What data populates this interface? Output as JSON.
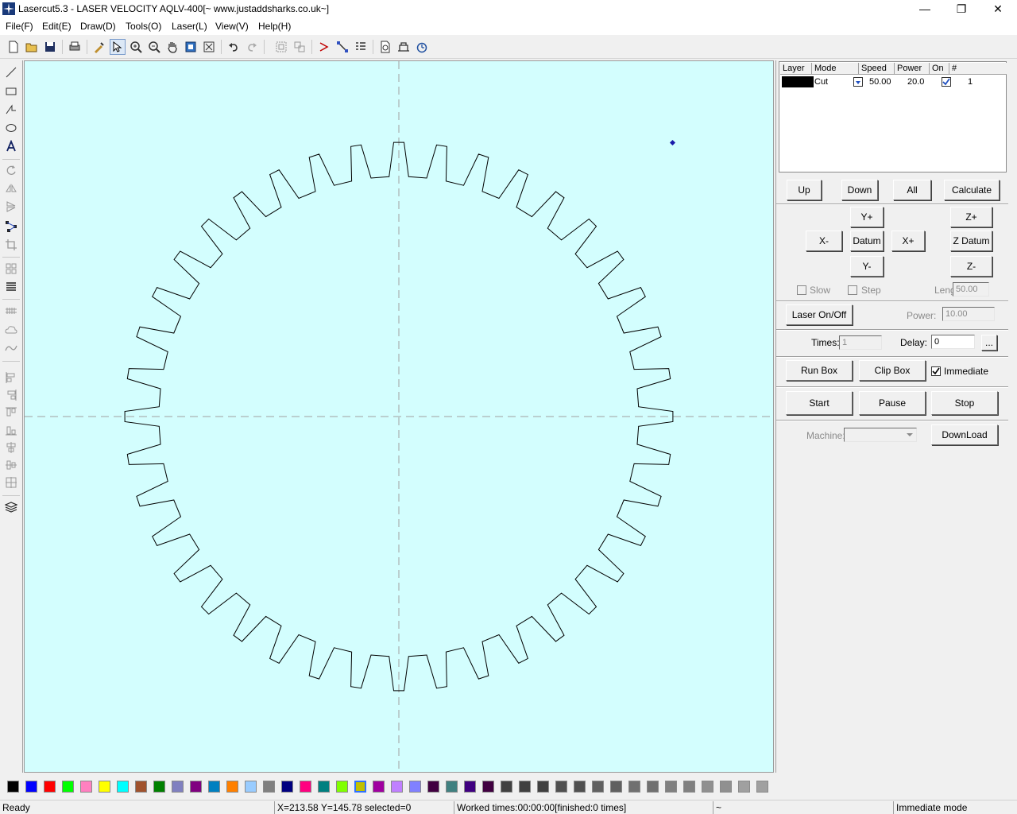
{
  "window": {
    "title": "Lasercut5.3 - LASER VELOCITY AQLV-400[~ www.justaddsharks.co.uk~]",
    "minimize": "—",
    "restore": "❐",
    "close": "✕"
  },
  "menu": [
    {
      "label": "File(F)"
    },
    {
      "label": "Edit(E)"
    },
    {
      "label": "Draw(D)"
    },
    {
      "label": "Tools(O)"
    },
    {
      "label": "Laser(L)"
    },
    {
      "label": "View(V)"
    },
    {
      "label": "Help(H)"
    }
  ],
  "toolbar_icons": [
    "new-file-icon",
    "open-folder-icon",
    "save-icon",
    "print-icon",
    "import-icon",
    "select-arrow-icon",
    "zoom-in-icon",
    "zoom-out-icon",
    "pan-hand-icon",
    "zoom-page-icon",
    "zoom-fit-icon",
    "undo-icon",
    "redo-icon",
    "group-icon",
    "ungroup-icon",
    "cut-path-icon",
    "node-edit-icon",
    "array-icon",
    "preview-icon",
    "machine-settings-icon",
    "timer-icon"
  ],
  "left_tools": [
    "line-icon",
    "rectangle-icon",
    "polyline-icon",
    "ellipse-icon",
    "text-icon",
    "rotate-icon",
    "mirror-horizontal-icon",
    "mirror-vertical-icon",
    "node-select-icon",
    "crop-icon",
    "array-copy-icon",
    "fill-icon",
    "hatch-icon",
    "cloud-icon",
    "smooth-curve-icon",
    "align-left-icon",
    "align-right-icon",
    "align-top-icon",
    "align-bottom-icon",
    "align-hcenter-icon",
    "align-vcenter-icon",
    "align-center-icon",
    "layers-icon"
  ],
  "layers": {
    "headers": [
      "Layer",
      "Mode",
      "Speed",
      "Power",
      "On",
      "#"
    ],
    "rows": [
      {
        "color": "#000000",
        "mode": "Cut",
        "speed": "50.00",
        "power": "20.0",
        "on": true,
        "number": "1"
      }
    ]
  },
  "controls": {
    "up": "Up",
    "down": "Down",
    "all": "All",
    "calculate": "Calculate",
    "y_plus": "Y+",
    "y_minus": "Y-",
    "x_minus": "X-",
    "x_plus": "X+",
    "datum": "Datum",
    "z_plus": "Z+",
    "z_datum": "Z Datum",
    "z_minus": "Z-",
    "slow": "Slow",
    "step": "Step",
    "length_label": "Length:",
    "length_value": "50.00",
    "laser_onoff": "Laser On/Off",
    "power_label": "Power:",
    "power_value": "10.00",
    "times_label": "Times:",
    "times_value": "1",
    "delay_label": "Delay:",
    "delay_value": "0",
    "delay_more": "...",
    "run_box": "Run Box",
    "clip_box": "Clip Box",
    "immediate": "Immediate",
    "immediate_checked": true,
    "start": "Start",
    "pause": "Pause",
    "stop": "Stop",
    "machine_label": "Machine:",
    "download": "DownLoad"
  },
  "gear": {
    "teeth": 40,
    "stroke": "#000000"
  },
  "palette": [
    "#000000",
    "#0000ff",
    "#ff0000",
    "#00ff00",
    "#ff80c0",
    "#ffff00",
    "#00ffff",
    "#a0522d",
    "#008000",
    "#8080c0",
    "#800080",
    "#0080c0",
    "#ff8000",
    "#99ccff",
    "#808080",
    "#000080",
    "#ff0080",
    "#008080",
    "#80ff00",
    "#c0c000",
    "#a000a0",
    "#c080ff",
    "#8080ff",
    "#400040",
    "#408080",
    "#400080",
    "#400040",
    "#404040",
    "#404040",
    "#404040",
    "#505050",
    "#505050",
    "#606060",
    "#606060",
    "#707070",
    "#707070",
    "#808080",
    "#808080",
    "#909090",
    "#909090",
    "#a0a0a0",
    "#a0a0a0"
  ],
  "status": {
    "ready": "Ready",
    "coords": "X=213.58 Y=145.78 selected=0",
    "worked": "Worked times:00:00:00[finished:0 times]",
    "tilde": "~",
    "mode": "Immediate mode"
  },
  "colors": {
    "canvas_bg": "#d3fefe",
    "axis": "#a0a0a0",
    "marker": "#1a1aaa"
  }
}
